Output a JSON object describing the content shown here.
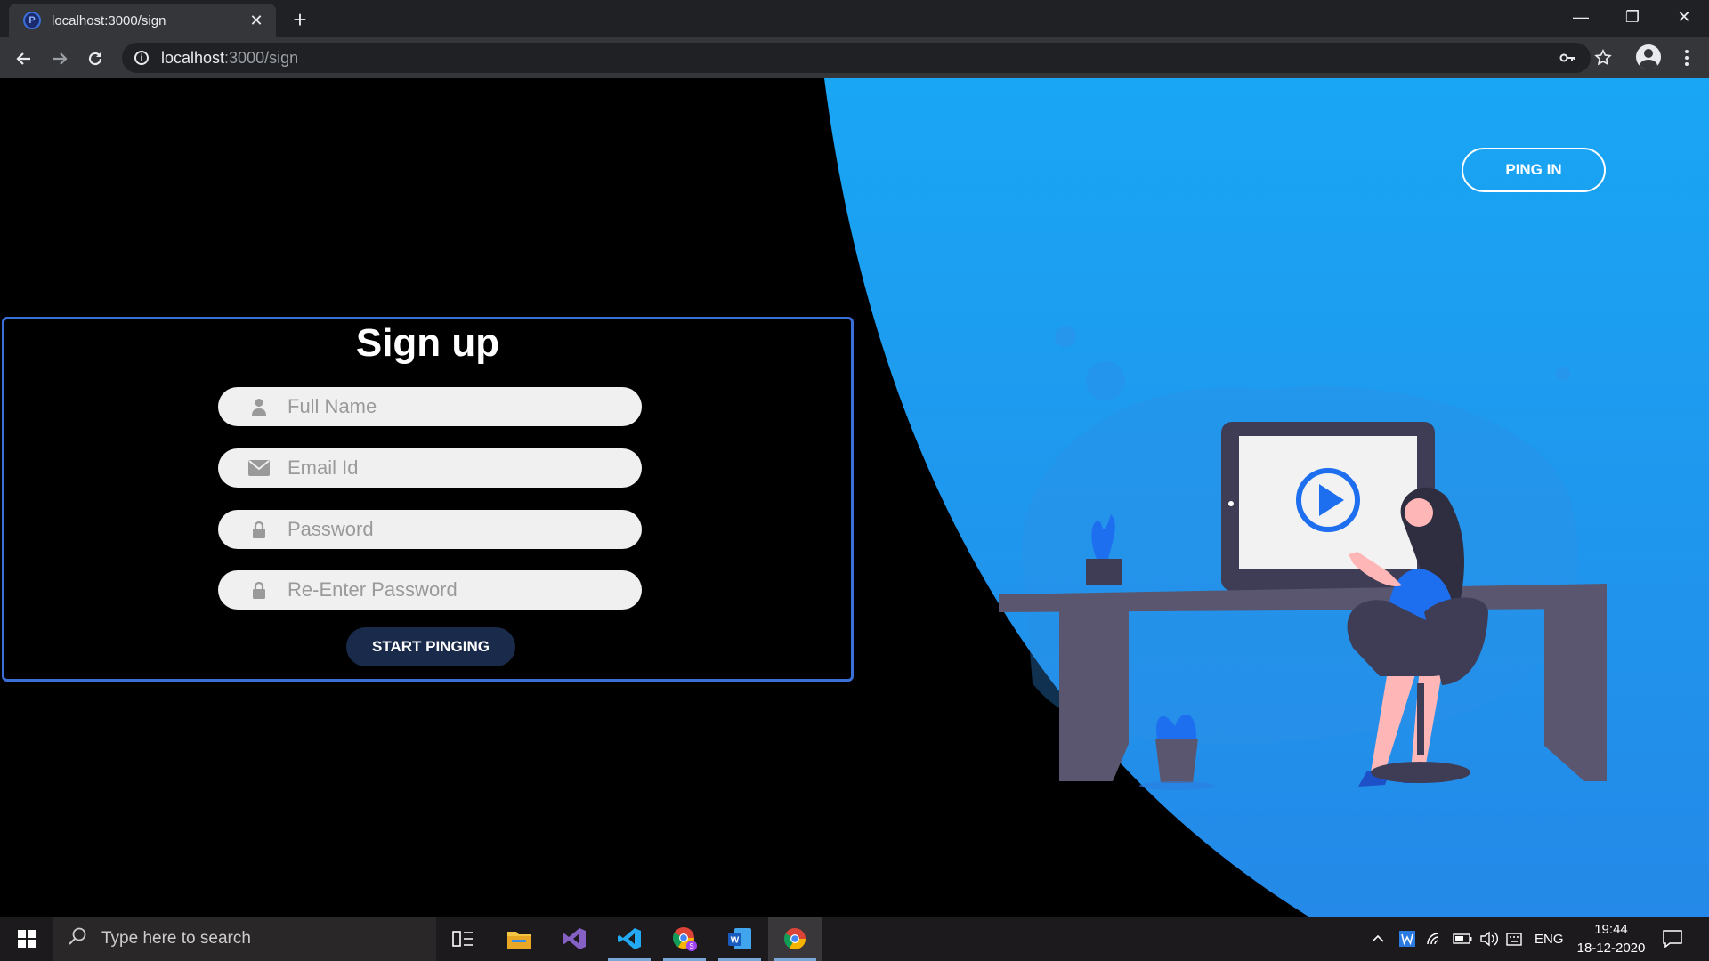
{
  "browser": {
    "tab_title": "localhost:3000/sign",
    "tab_close": "✕",
    "new_tab": "+",
    "url_host": "localhost",
    "url_path": ":3000/sign",
    "window_controls": {
      "minimize": "—",
      "restore": "❐",
      "close": "✕"
    }
  },
  "page": {
    "signup_title": "Sign up",
    "ping_in_label": "PING IN",
    "fields": [
      {
        "placeholder": "Full Name",
        "icon": "user-icon"
      },
      {
        "placeholder": "Email Id",
        "icon": "envelope-icon"
      },
      {
        "placeholder": "Password",
        "icon": "lock-icon"
      },
      {
        "placeholder": "Re-Enter Password",
        "icon": "lock-icon"
      }
    ],
    "submit_label": "START PINGING",
    "colors": {
      "blue": "#1e9af0",
      "form_border": "#3b6fd8",
      "button": "#1a2a4a"
    }
  },
  "taskbar": {
    "search_placeholder": "Type here to search",
    "language": "ENG",
    "time": "19:44",
    "date": "18-12-2020",
    "apps": [
      "task-view",
      "file-explorer",
      "visual-studio",
      "vscode",
      "chrome-profile",
      "word",
      "chrome"
    ]
  }
}
